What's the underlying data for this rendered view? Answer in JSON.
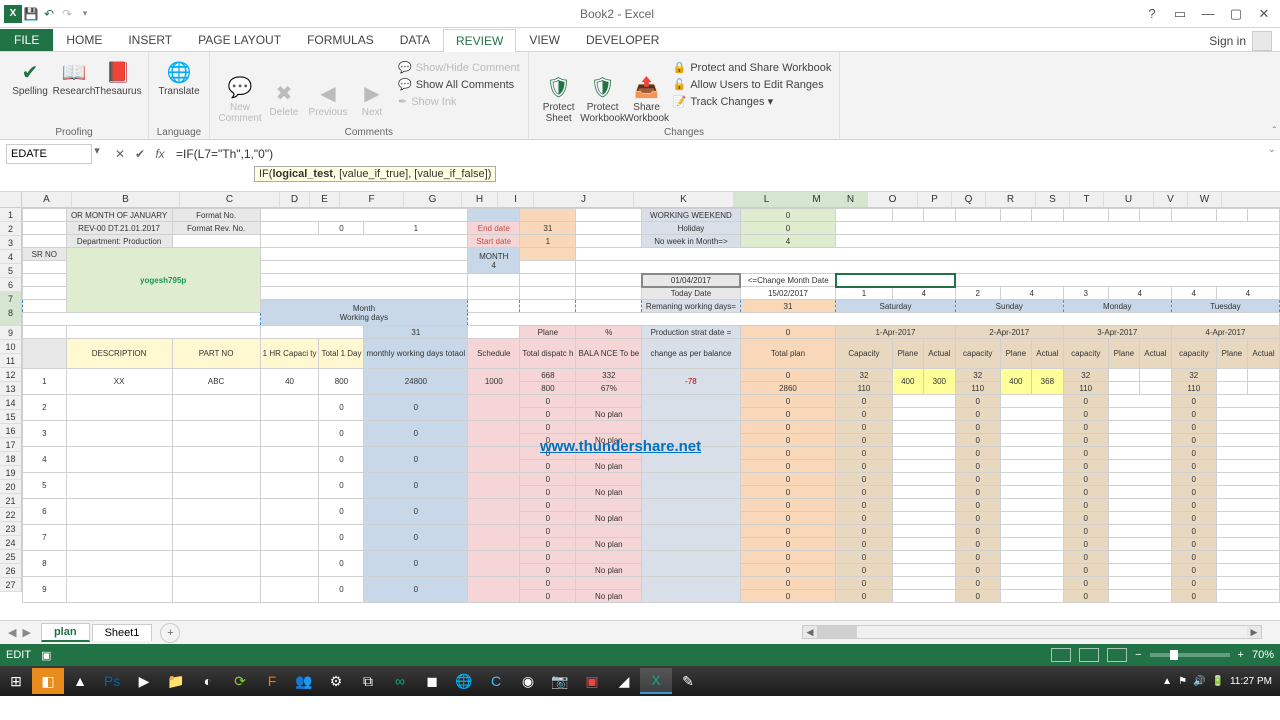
{
  "title": "Book2 - Excel",
  "tabs": {
    "file": "FILE",
    "list": [
      "HOME",
      "INSERT",
      "PAGE LAYOUT",
      "FORMULAS",
      "DATA",
      "REVIEW",
      "VIEW",
      "DEVELOPER"
    ],
    "active": 5,
    "signin": "Sign in"
  },
  "ribbon": {
    "proofing": {
      "label": "Proofing",
      "spelling": "Spelling",
      "research": "Research",
      "thesaurus": "Thesaurus"
    },
    "language": {
      "label": "Language",
      "translate": "Translate"
    },
    "comments": {
      "label": "Comments",
      "new": "New\nComment",
      "delete": "Delete",
      "previous": "Previous",
      "next": "Next",
      "show_hide": "Show/Hide Comment",
      "show_all": "Show All Comments",
      "show_ink": "Show Ink"
    },
    "changes": {
      "label": "Changes",
      "protect_sheet": "Protect\nSheet",
      "protect_wb": "Protect\nWorkbook",
      "share": "Share\nWorkbook",
      "protect_share": "Protect and Share Workbook",
      "allow_ranges": "Allow Users to Edit Ranges",
      "track": "Track Changes ▾"
    }
  },
  "fbar": {
    "namebox": "EDATE",
    "formula": "=IF(L7=\"Th\",1,\"0\")",
    "tooltip_fn": "IF(",
    "tooltip_args": "logical_test",
    "tooltip_rest": ", [value_if_true], [value_if_false])"
  },
  "cols": [
    {
      "l": "A",
      "w": 50
    },
    {
      "l": "B",
      "w": 108
    },
    {
      "l": "C",
      "w": 100
    },
    {
      "l": "D",
      "w": 30
    },
    {
      "l": "E",
      "w": 30
    },
    {
      "l": "F",
      "w": 64
    },
    {
      "l": "G",
      "w": 58
    },
    {
      "l": "H",
      "w": 36
    },
    {
      "l": "I",
      "w": 36
    },
    {
      "l": "J",
      "w": 100
    },
    {
      "l": "K",
      "w": 100
    },
    {
      "l": "L",
      "w": 66
    },
    {
      "l": "M",
      "w": 34
    },
    {
      "l": "N",
      "w": 34
    },
    {
      "l": "O",
      "w": 50
    },
    {
      "l": "P",
      "w": 34
    },
    {
      "l": "Q",
      "w": 34
    },
    {
      "l": "R",
      "w": 50
    },
    {
      "l": "S",
      "w": 34
    },
    {
      "l": "T",
      "w": 34
    },
    {
      "l": "U",
      "w": 50
    },
    {
      "l": "V",
      "w": 34
    },
    {
      "l": "W",
      "w": 34
    }
  ],
  "rows": [
    "1",
    "2",
    "3",
    "4",
    "5",
    "6",
    "7",
    "8",
    "",
    "9",
    "10",
    "11",
    "12",
    "13",
    "14",
    "15",
    "16",
    "17",
    "18",
    "19",
    "20",
    "21",
    "22",
    "23",
    "24",
    "25",
    "26",
    "27"
  ],
  "sheet_tabs": [
    "plan",
    "Sheet1"
  ],
  "sheet_active": 0,
  "status": {
    "mode": "EDIT",
    "zoom": "70%"
  },
  "taskbar": {
    "time": "11:27 PM"
  },
  "watermark": "www.thundershare.net",
  "green_text": "yogesh795p",
  "data_blocks": {
    "r1": {
      "b": "OR MONTH OF JANUARY",
      "c": "Format No.",
      "j": "WORKING WEEKEND",
      "k": "0"
    },
    "r2": {
      "b": "REV-00 DT.21.01.2017",
      "c": "Format Rev. No.",
      "e": "0",
      "f": "1",
      "g": "End date",
      "h": "31",
      "j": "Holiday",
      "k": "0"
    },
    "r3": {
      "b": "Department: Production",
      "g": "Start date",
      "h": "1",
      "j": "No week in Month=>",
      "k": "4"
    },
    "r4": {
      "a": "SR NO",
      "g": "MONTH\n4"
    },
    "r6": {
      "j": "01/04/2017",
      "k": "<=Change Month Date"
    },
    "r7": {
      "j": "Today Date",
      "k": "15/02/2017",
      "l": "1",
      "m": "4",
      "o": "2",
      "p": "4",
      "r": "3",
      "s": "4",
      "u": "4",
      "v": "4"
    },
    "r8": {
      "f": "Month\nWorking days",
      "j": "Remaning working days=",
      "k": "31",
      "lm": "Saturday",
      "op": "Sunday",
      "rs": "Monday",
      "uv": "Tuesday"
    },
    "dash": {
      "lm": "Saturday",
      "op": "Sunday",
      "rs": "Monday",
      "uv": "Tuesday"
    },
    "r9": {
      "f": "31",
      "h": "Plane",
      "i": "%",
      "j": "Production strat date =",
      "k": "0",
      "lm": "1-Apr-2017",
      "op": "2-Apr-2017",
      "rs": "3-Apr-2017",
      "uv": "4-Apr-2017"
    },
    "headers": {
      "desc": "DESCRIPTION",
      "part": "PART NO",
      "d": "1 HR\nCapaci\nty",
      "e": "Total\n1 Day",
      "f": "monthly\nworking days\ntotaol",
      "g": "Schedule",
      "h": "Total\ndispatc\nh",
      "i": "BALA\nNCE\nTo be",
      "j": "change as\nper balance",
      "k": "Total plan",
      "l": "Capacity",
      "m": "Plane",
      "n": "Actual",
      "o": "capacity",
      "p": "Plane",
      "q": "Actual",
      "r": "capacity",
      "s": "Plane",
      "t": "Actual",
      "u": "capacity",
      "v": "Plane",
      "w": "Actual"
    },
    "row_a": {
      "srno": "1",
      "desc": "XX",
      "part": "ABC",
      "d": "40",
      "e": "800",
      "f": "24800",
      "g": "1000",
      "h1": "668",
      "i1": "332",
      "h2": "800",
      "i2": "67%",
      "j": "-78",
      "k1": "0",
      "k2": "2860",
      "l1": "32",
      "l2": "110",
      "m": "400",
      "n": "300",
      "o1": "32",
      "o2": "110",
      "p": "400",
      "q": "368",
      "r1": "32",
      "r2": "110",
      "u1": "32",
      "u2": "110"
    },
    "zero_rows": [
      {
        "sr": "2",
        "h": "0",
        "i": "No plan"
      },
      {
        "sr": "3",
        "h": "0",
        "i": "No plan"
      },
      {
        "sr": "4",
        "h": "0",
        "i": "No plan"
      },
      {
        "sr": "5",
        "h": "0",
        "i": "No plan"
      },
      {
        "sr": "6",
        "h": "0",
        "i": "No plan"
      },
      {
        "sr": "7",
        "h": "0",
        "i": "No plan"
      },
      {
        "sr": "8",
        "h": "0",
        "i": "No plan"
      },
      {
        "sr": "9",
        "h": "0",
        "i": "No plan"
      }
    ]
  }
}
